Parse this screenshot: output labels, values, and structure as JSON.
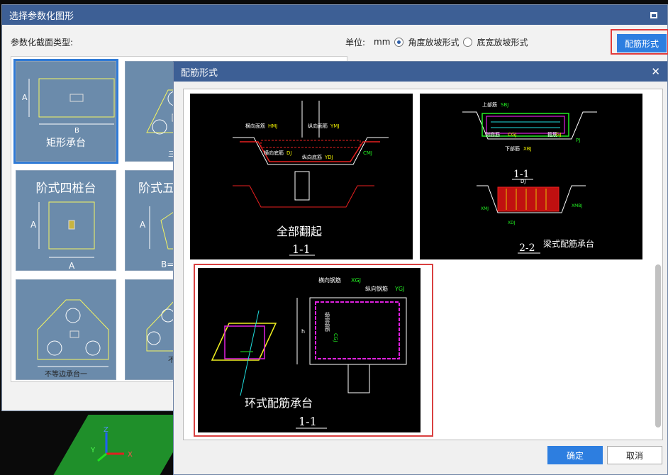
{
  "main_window": {
    "title": "选择参数化图形",
    "section_label": "参数化截面类型:",
    "unit_label": "单位:",
    "unit_value": "mm",
    "radio_angle": "角度放坡形式",
    "radio_width": "底宽放坡形式",
    "rebar_button": "配筋形式"
  },
  "thumbnails": [
    {
      "caption": "矩形承台",
      "dim_a": "A",
      "dim_b": "B",
      "selected": true
    },
    {
      "caption": "三桩",
      "selected": false
    },
    {
      "caption": "阶式四桩台",
      "dim_a": "A",
      "dim_b": "A",
      "selected": false
    },
    {
      "caption": "阶式五",
      "dim_a": "A",
      "dim_b": "B=A",
      "selected": false
    },
    {
      "caption": "不等边承台一",
      "selected": false
    },
    {
      "caption": "不等",
      "selected": false
    }
  ],
  "dialog": {
    "title": "配筋形式",
    "ok_button": "确定",
    "cancel_button": "取消",
    "options": [
      {
        "title": "全部翻起",
        "section": "1-1",
        "labels": {
          "top": "横向面筋",
          "top_code": "HMJ",
          "top2": "纵向面筋",
          "top2_code": "YMJ",
          "bottom": "横向底筋",
          "bottom_code": "DJ",
          "bottom2": "纵向底筋",
          "bottom2_code": "YDJ",
          "side": "CMJ"
        }
      },
      {
        "title": "梁式配筋承台",
        "section1": "1-1",
        "section2": "2-2",
        "labels": {
          "top": "上部筋",
          "top_code": "SBJ",
          "side": "侧面筋",
          "side_code": "CGJ",
          "bottom": "下部筋",
          "bottom_code": "XBJ",
          "stirrup": "箍筋",
          "stirrup_code": "GJ",
          "pj": "PJ",
          "dj": "DJ",
          "xmj": "XMJ",
          "xmbj": "XMBJ",
          "xdj": "XDJ"
        }
      },
      {
        "title": "环式配筋承台",
        "section": "1-1",
        "labels": {
          "horizontal": "横向钢筋",
          "horizontal_code": "XGJ",
          "vertical": "纵向钢筋",
          "vertical_code": "YGJ",
          "ring": "CGJ",
          "side_text": "钢侧钢筋",
          "dim": "h"
        }
      }
    ]
  },
  "colors": {
    "title_bar": "#3d5f95",
    "primary_button": "#2d7ee0",
    "highlight": "#d94040",
    "cad_bg": "#000000",
    "cad_green": "#22e022",
    "cad_magenta": "#e020e0",
    "cad_yellow": "#f0f020",
    "cad_cyan": "#20e0e0",
    "cad_red": "#e82020"
  },
  "viewport": {
    "axis_x": "X",
    "axis_y": "Y",
    "axis_z": "Z"
  }
}
